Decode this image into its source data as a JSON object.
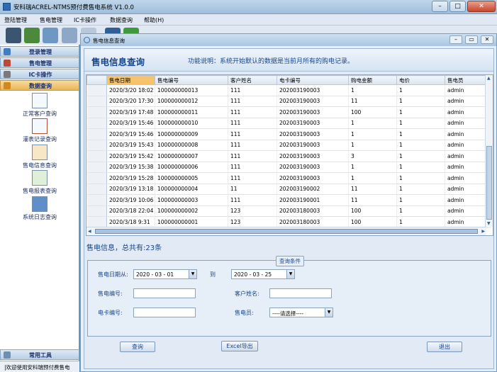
{
  "window": {
    "title": "安科瑞ACREL-NTMS预付费售电系统 V1.0.0"
  },
  "menu": [
    "登陆管理",
    "售电管理",
    "IC卡操作",
    "数据查询",
    "帮助(H)"
  ],
  "sidebar": {
    "sections": [
      "登录管理",
      "售电管理",
      "IC卡操作",
      "数据查询"
    ],
    "items": [
      "正常客户查询",
      "灌表记录查询",
      "售电信息查询",
      "售电报表查询",
      "系统日志查询"
    ],
    "bottom": "常用工具",
    "status": "|欢迎使用安科瑞预付费售电"
  },
  "child": {
    "title": "售电信息查询"
  },
  "header": {
    "title": "售电信息查询",
    "desc": "功能说明：系统开始默认的数据是当前月所有的购电记录。"
  },
  "grid": {
    "columns": [
      "售电日期",
      "售电编号",
      "客户姓名",
      "电卡编号",
      "购电金额",
      "电价",
      "售电员"
    ],
    "rows": [
      [
        "2020/3/20 18:02",
        "100000000013",
        "111",
        "202003190003",
        "1",
        "1",
        "admin"
      ],
      [
        "2020/3/20 17:30",
        "100000000012",
        "111",
        "202003190003",
        "11",
        "1",
        "admin"
      ],
      [
        "2020/3/19 17:48",
        "100000000011",
        "111",
        "202003190003",
        "100",
        "1",
        "admin"
      ],
      [
        "2020/3/19 15:46",
        "100000000010",
        "111",
        "202003190003",
        "1",
        "1",
        "admin"
      ],
      [
        "2020/3/19 15:46",
        "100000000009",
        "111",
        "202003190003",
        "1",
        "1",
        "admin"
      ],
      [
        "2020/3/19 15:43",
        "100000000008",
        "111",
        "202003190003",
        "1",
        "1",
        "admin"
      ],
      [
        "2020/3/19 15:42",
        "100000000007",
        "111",
        "202003190003",
        "3",
        "1",
        "admin"
      ],
      [
        "2020/3/19 15:38",
        "100000000006",
        "111",
        "202003190003",
        "1",
        "1",
        "admin"
      ],
      [
        "2020/3/19 15:28",
        "100000000005",
        "111",
        "202003190003",
        "1",
        "1",
        "admin"
      ],
      [
        "2020/3/19 13:18",
        "100000000004",
        "11",
        "202003190002",
        "11",
        "1",
        "admin"
      ],
      [
        "2020/3/19 10:06",
        "100000000003",
        "111",
        "202003190001",
        "11",
        "1",
        "admin"
      ],
      [
        "2020/3/18 22:04",
        "100000000002",
        "123",
        "202003180003",
        "100",
        "1",
        "admin"
      ],
      [
        "2020/3/18 9:31",
        "100000000001",
        "123",
        "202003180003",
        "100",
        "1",
        "admin"
      ]
    ]
  },
  "summary": "售电信息，总共有:23条",
  "query": {
    "group_title": "查询条件",
    "date_from_label": "售电日期从:",
    "date_from": "2020 - 03 - 01",
    "to_label": "到",
    "date_to": "2020 - 03 - 25",
    "sale_no_label": "售电编号:",
    "sale_no": "",
    "customer_label": "客户姓名:",
    "customer": "",
    "card_label": "电卡编号:",
    "card": "",
    "clerk_label": "售电员:",
    "clerk": "----请选择----"
  },
  "buttons": {
    "query": "查询",
    "excel": "Excel导出",
    "exit": "退出"
  },
  "colors": {
    "accent": "#17458a",
    "sort_header": "#f7c36a",
    "active_section": "#e9b456"
  }
}
